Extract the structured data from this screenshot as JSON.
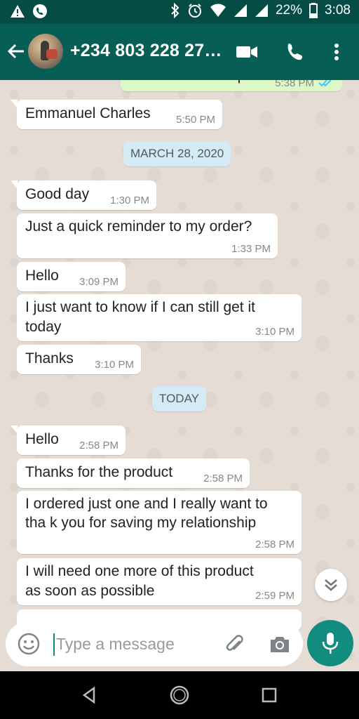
{
  "status": {
    "battery": "22%",
    "time": "3:08"
  },
  "header": {
    "title": "+234 803 228 27…"
  },
  "messages": {
    "partial_top": {
      "text": "Your name please?",
      "time": "5:38 PM"
    },
    "m1": {
      "text": "Emmanuel Charles",
      "time": "5:50 PM"
    },
    "date1": "MARCH 28, 2020",
    "m2": {
      "text": "Good day",
      "time": "1:30 PM"
    },
    "m3": {
      "text": "Just a quick reminder to my order?",
      "time": "1:33 PM"
    },
    "m4": {
      "text": "Hello",
      "time": "3:09 PM"
    },
    "m5": {
      "line1": "I just want to know if I can still get it",
      "line2": "today",
      "time": "3:10 PM"
    },
    "m6": {
      "text": "Thanks",
      "time": "3:10 PM"
    },
    "date2": "TODAY",
    "m7": {
      "text": "Hello",
      "time": "2:58 PM"
    },
    "m8": {
      "text": "Thanks for the product",
      "time": "2:58 PM"
    },
    "m9": {
      "line1": "I ordered just one and I really want to",
      "line2": "tha k you for saving my relationship",
      "time": "2:58 PM"
    },
    "m10": {
      "line1": "I will need one more of this product",
      "line2": "as soon as possible",
      "time": "2:59 PM"
    }
  },
  "composer": {
    "placeholder": "Type a message"
  },
  "icons": {
    "back": "arrow-left-icon",
    "video": "video-call-icon",
    "call": "phone-icon",
    "menu": "more-vert-icon",
    "emoji": "emoji-icon",
    "attach": "paperclip-icon",
    "camera": "camera-icon",
    "mic": "mic-icon",
    "scroll": "double-chevron-down-icon"
  },
  "colors": {
    "header": "#075e54",
    "statusbar": "#054d44",
    "accent": "#128c7e",
    "chat_bg": "#e5ddd5",
    "date_chip": "#d4eaf4"
  }
}
